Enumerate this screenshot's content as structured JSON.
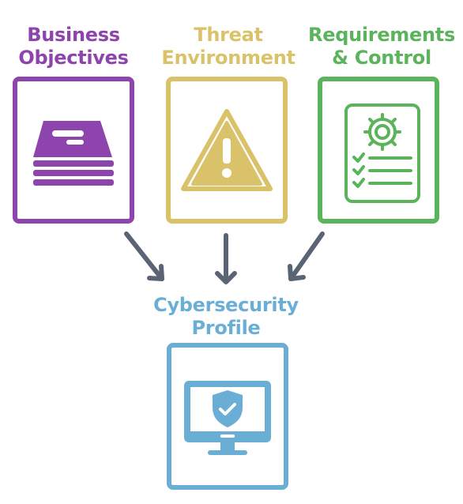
{
  "colors": {
    "business": "#8e44ad",
    "threat": "#d9c26a",
    "requirements": "#5bb35b",
    "profile": "#6aaed6",
    "arrow": "#5b6475"
  },
  "nodes": {
    "business": {
      "line1": "Business",
      "line2": "Objectives",
      "icon": "document-stack-icon"
    },
    "threat": {
      "line1": "Threat",
      "line2": "Environment",
      "icon": "warning-triangle-icon"
    },
    "requirements": {
      "line1": "Requirements",
      "line2": "& Control",
      "icon": "checklist-gear-icon"
    },
    "profile": {
      "line1": "Cybersecurity",
      "line2": "Profile",
      "icon": "monitor-shield-icon"
    }
  }
}
